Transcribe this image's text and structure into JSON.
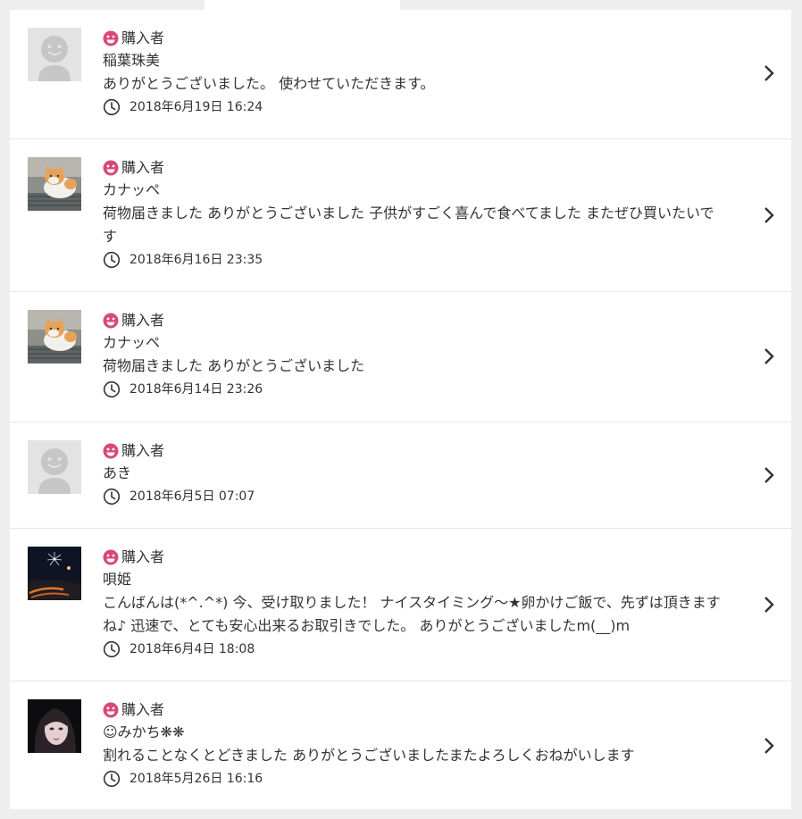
{
  "colors": {
    "accent": "#d9487a",
    "text": "#333333"
  },
  "reviews": [
    {
      "role": "購入者",
      "name": "稲葉珠美",
      "message": "ありがとうございました。 使わせていただきます。",
      "date": "2018年6月19日 16:24",
      "avatar": "default-avatar-icon"
    },
    {
      "role": "購入者",
      "name": "カナッペ",
      "message": "荷物届きました ありがとうございました 子供がすごく喜んで食べてました またぜひ買いたいです",
      "date": "2018年6月16日 23:35",
      "avatar": "cat-photo-avatar"
    },
    {
      "role": "購入者",
      "name": "カナッペ",
      "message": "荷物届きました ありがとうございました",
      "date": "2018年6月14日 23:26",
      "avatar": "cat-photo-avatar"
    },
    {
      "role": "購入者",
      "name": "あき",
      "message": "",
      "date": "2018年6月5日 07:07",
      "avatar": "default-avatar-icon"
    },
    {
      "role": "購入者",
      "name": "唄姫",
      "message": "こんばんは(*^.^*) 今、受け取りました！ ナイスタイミング〜★卵かけご飯で、先ずは頂きますね♪ 迅速で、とても安心出来るお取引きでした。 ありがとうございましたm(__)m",
      "date": "2018年6月4日 18:08",
      "avatar": "fireworks-photo-avatar"
    },
    {
      "role": "購入者",
      "name": "☺みかち❋❋",
      "message": "割れることなくとどきました ありがとうございましたまたよろしくおねがいします",
      "date": "2018年5月26日 16:16",
      "avatar": "person-photo-avatar"
    }
  ]
}
